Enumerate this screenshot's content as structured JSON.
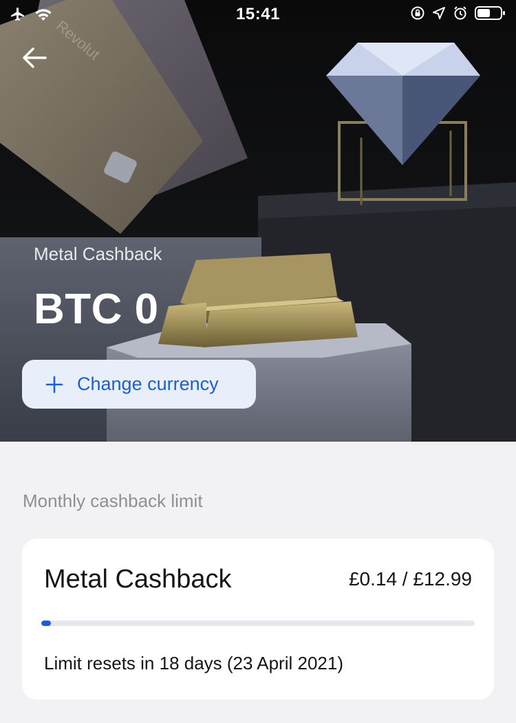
{
  "status_bar": {
    "time": "15:41",
    "left_icons": [
      "airplane-mode-icon",
      "wifi-icon"
    ],
    "right_icons": [
      "orientation-lock-icon",
      "location-icon",
      "alarm-icon",
      "battery-icon"
    ]
  },
  "hero": {
    "back_icon": "arrow-left-icon",
    "subtitle": "Metal Cashback",
    "balance": "BTC 0",
    "change_currency": {
      "icon": "plus-icon",
      "label": "Change currency"
    },
    "card_brand_text": "Revolut"
  },
  "limit_section": {
    "label": "Monthly cashback limit",
    "card": {
      "title": "Metal Cashback",
      "amount": "£0.14 / £12.99",
      "progress_fraction": 0.0108,
      "reset_text": "Limit resets in 18 days (23 April 2021)"
    }
  },
  "colors": {
    "accent": "#1a5fd7",
    "button_bg": "#e9eefb",
    "page_bg": "#f2f2f4",
    "hero_bg": "#0b0b0c"
  }
}
